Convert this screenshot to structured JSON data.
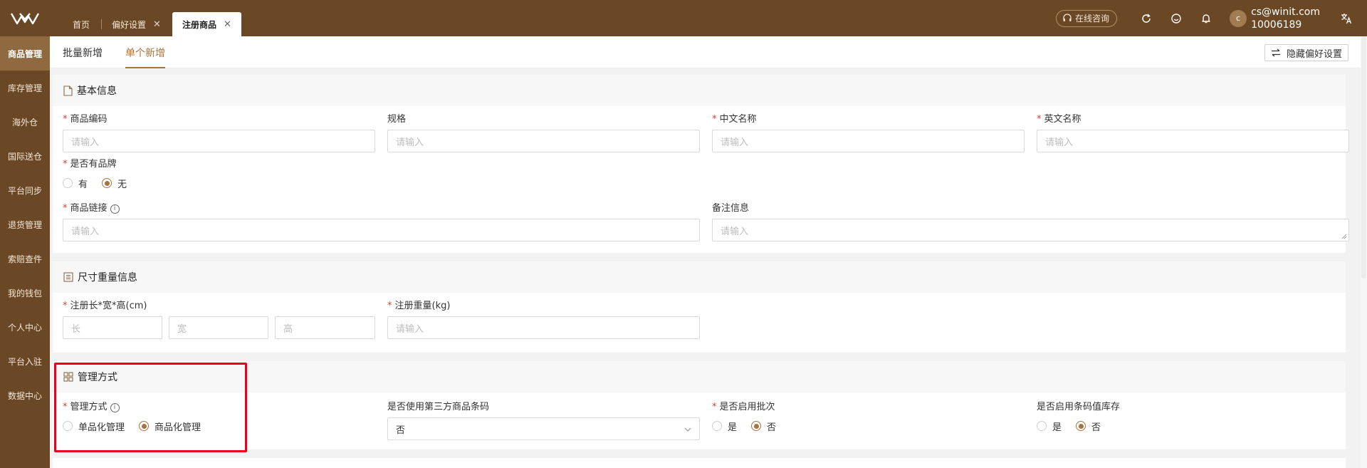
{
  "topbar": {
    "tabs": [
      {
        "label": "首页"
      },
      {
        "label": "偏好设置"
      },
      {
        "label": "注册商品"
      }
    ],
    "consult_label": "在线咨询",
    "user_email": "cs@winit.com",
    "user_id": "10006189",
    "avatar_letter": "c"
  },
  "sidebar": {
    "items": [
      {
        "label": "商品管理"
      },
      {
        "label": "库存管理"
      },
      {
        "label": "海外仓"
      },
      {
        "label": "国际送仓"
      },
      {
        "label": "平台同步"
      },
      {
        "label": "退货管理"
      },
      {
        "label": "索赔查件"
      },
      {
        "label": "我的钱包"
      },
      {
        "label": "个人中心"
      },
      {
        "label": "平台入驻"
      },
      {
        "label": "数据中心"
      }
    ]
  },
  "subtabs": {
    "batch": "批量新增",
    "single": "单个新增",
    "hide_pref": "隐藏偏好设置"
  },
  "basic": {
    "title": "基本信息",
    "sku_label": "商品编码",
    "spec_label": "规格",
    "cn_name_label": "中文名称",
    "en_name_label": "英文名称",
    "brand_label": "是否有品牌",
    "brand_yes": "有",
    "brand_no": "无",
    "link_label": "商品链接",
    "remark_label": "备注信息",
    "placeholder": "请输入"
  },
  "size": {
    "title": "尺寸重量信息",
    "dim_label": "注册长*宽*高(cm)",
    "weight_label": "注册重量(kg)",
    "length_ph": "长",
    "width_ph": "宽",
    "height_ph": "高",
    "placeholder": "请输入"
  },
  "manage": {
    "title": "管理方式",
    "mode_label": "管理方式",
    "mode_single": "单品化管理",
    "mode_goods": "商品化管理",
    "third_label": "是否使用第三方商品条码",
    "third_value": "否",
    "batch_label": "是否启用批次",
    "batch_yes": "是",
    "batch_no": "否",
    "barcode_label": "是否启用条码值库存",
    "barcode_yes": "是",
    "barcode_no": "否"
  },
  "colors": {
    "brand_brown": "#6a4826",
    "accent": "#a8743e",
    "required": "#e0402b",
    "highlight": "#e8001c"
  }
}
